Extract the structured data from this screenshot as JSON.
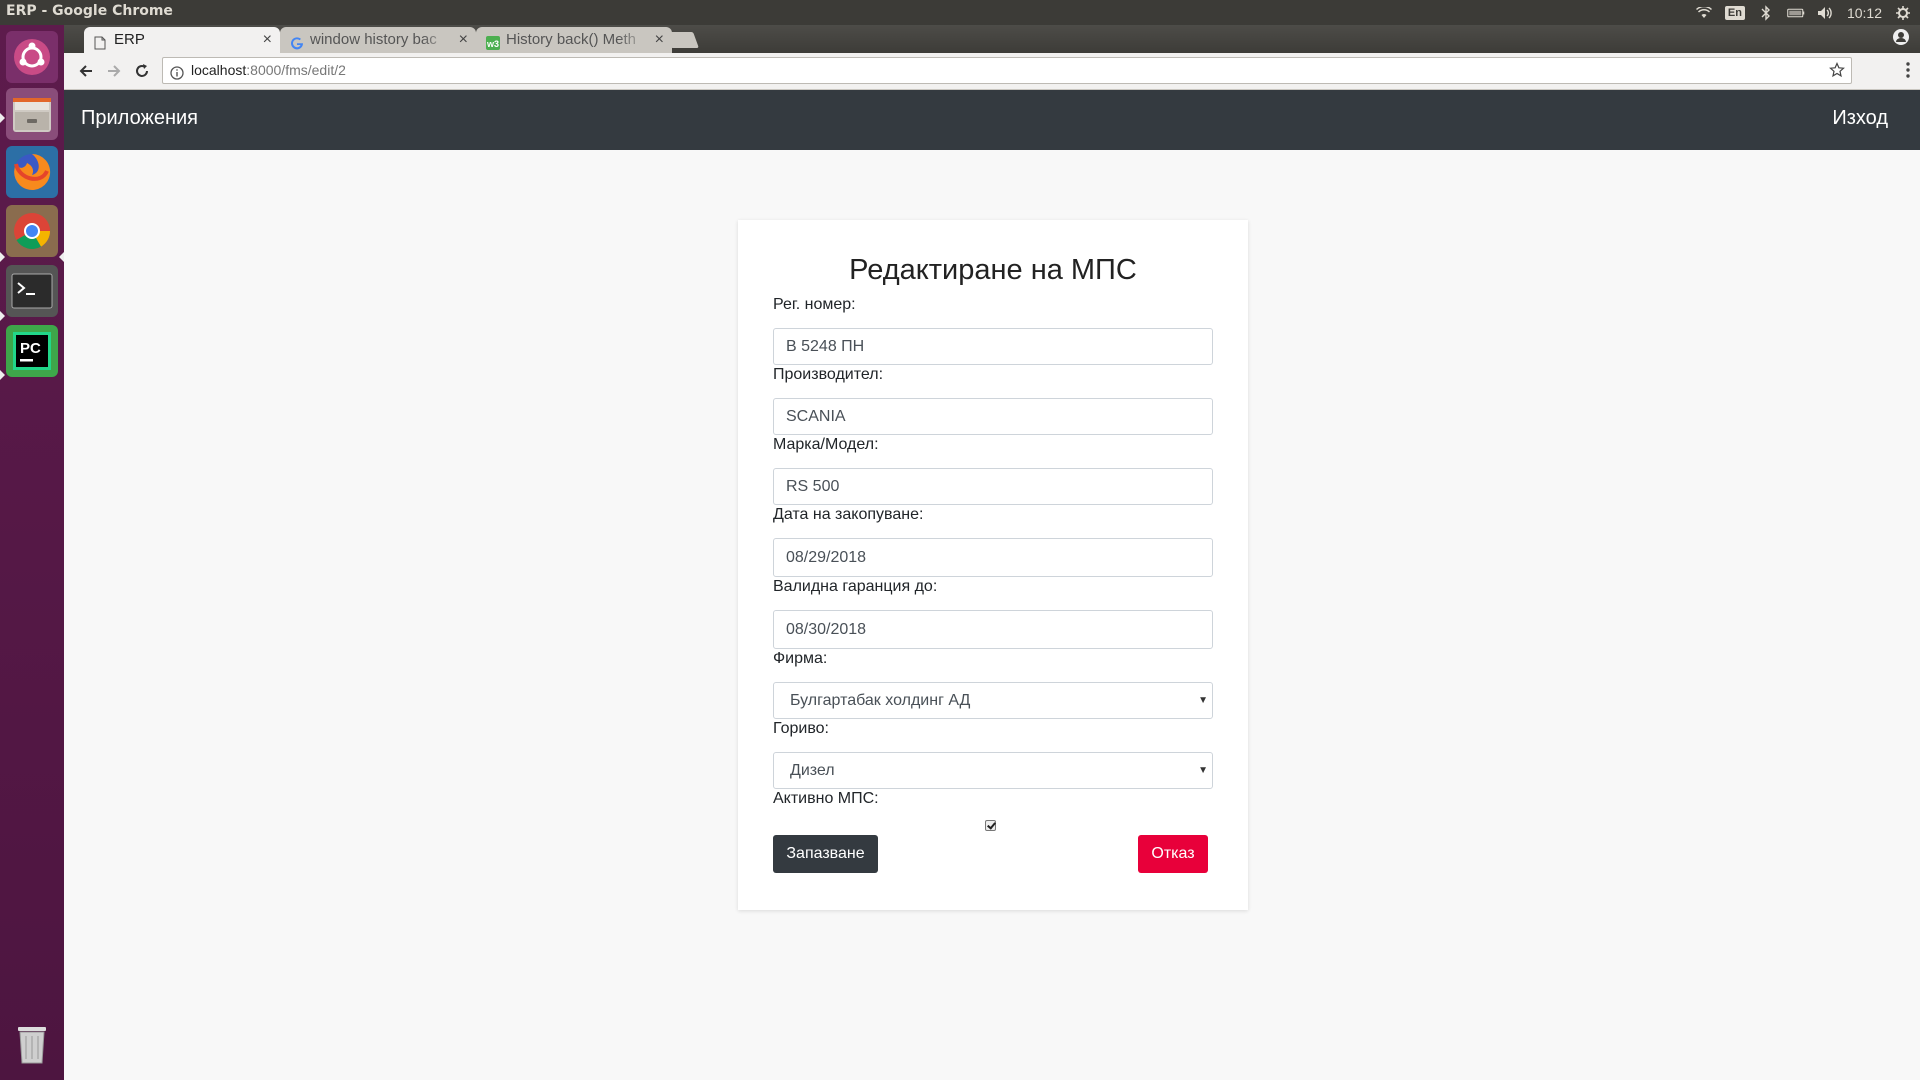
{
  "os": {
    "window_title": "ERP - Google Chrome",
    "lang": "En",
    "clock": "10:12"
  },
  "browser": {
    "tabs": [
      {
        "label": "ERP",
        "active": true
      },
      {
        "label": "window history bac",
        "active": false
      },
      {
        "label": "History back() Meth",
        "active": false
      }
    ],
    "url_host": "localhost",
    "url_path": ":8000/fms/edit/2"
  },
  "app": {
    "brand": "Приложения",
    "logout": "Изход"
  },
  "form": {
    "title": "Редактиране на МПС",
    "reg_label": "Рег. номер:",
    "reg_value": "В 5248 ПН",
    "manufacturer_label": "Производител:",
    "manufacturer_value": "SCANIA",
    "model_label": "Марка/Модел:",
    "model_value": "RS 500",
    "purchase_label": "Дата на закопуване:",
    "purchase_value": "08/29/2018",
    "warranty_label": "Валидна гаранция до:",
    "warranty_value": "08/30/2018",
    "company_label": "Фирма:",
    "company_value": "Булгартабак холдинг АД",
    "fuel_label": "Гориво:",
    "fuel_value": "Дизел",
    "active_label": "Активно МПС:",
    "active_checked": true,
    "save_label": "Запазване",
    "cancel_label": "Отказ"
  },
  "colors": {
    "navbar": "#343a40",
    "cancel": "#e8003a",
    "launcher": "#5b1a4a"
  }
}
